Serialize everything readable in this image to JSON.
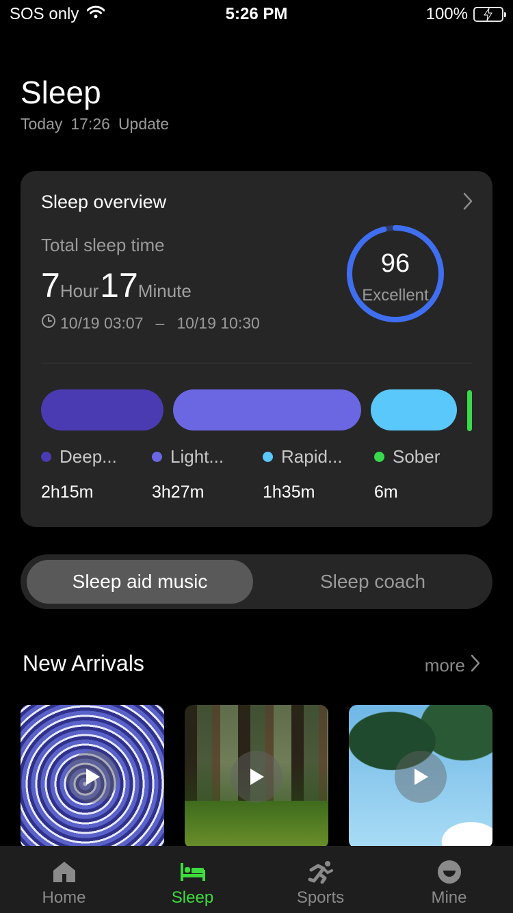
{
  "status_bar": {
    "carrier": "SOS only",
    "time": "5:26 PM",
    "battery": "100%"
  },
  "header": {
    "title": "Sleep",
    "subtitle_day": "Today",
    "subtitle_time": "17:26",
    "subtitle_action": "Update"
  },
  "overview": {
    "title": "Sleep overview",
    "total_label": "Total sleep time",
    "hours": "7",
    "hour_unit": "Hour",
    "minutes": "17",
    "minute_unit": "Minute",
    "start": "10/19 03:07",
    "dash": "–",
    "end": "10/19 10:30",
    "score": "96",
    "score_label": "Excellent",
    "score_fraction": 0.96,
    "stages": [
      {
        "label": "Deep...",
        "value": "2h15m",
        "color": "#4a3bb3"
      },
      {
        "label": "Light...",
        "value": "3h27m",
        "color": "#6b67e3"
      },
      {
        "label": "Rapid...",
        "value": "1h35m",
        "color": "#5ac8fa"
      },
      {
        "label": "Sober",
        "value": "6m",
        "color": "#38d94a"
      }
    ]
  },
  "segment": {
    "active": "Sleep aid music",
    "inactive": "Sleep coach"
  },
  "arrivals": {
    "title": "New Arrivals",
    "more": "more"
  },
  "tabs": [
    {
      "label": "Home",
      "icon": "home-icon"
    },
    {
      "label": "Sleep",
      "icon": "bed-icon",
      "active": true
    },
    {
      "label": "Sports",
      "icon": "running-icon"
    },
    {
      "label": "Mine",
      "icon": "profile-icon"
    }
  ],
  "colors": {
    "accent_green": "#3ddc3d",
    "ring_blue": "#3f6ff0"
  }
}
